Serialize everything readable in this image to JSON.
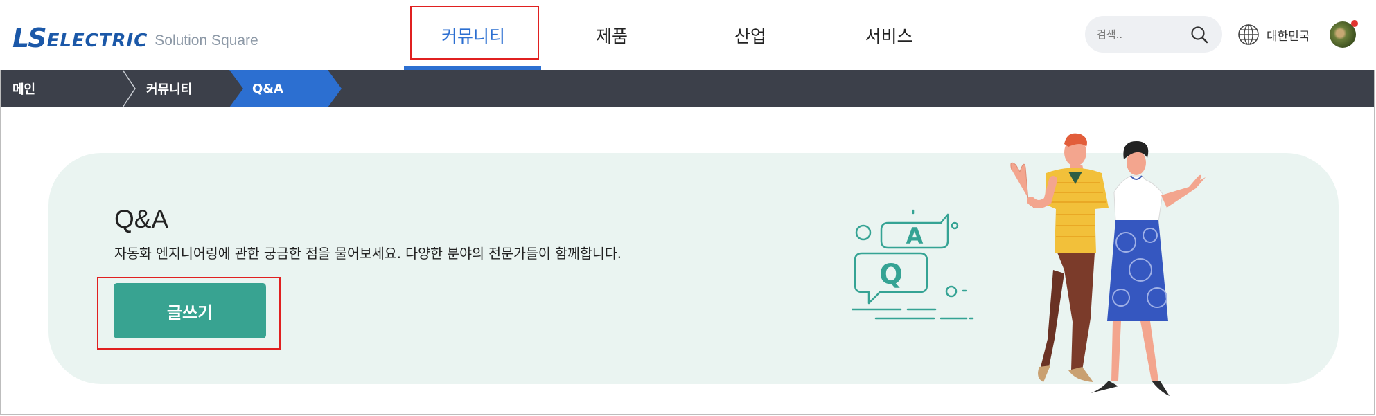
{
  "header": {
    "logo_main": "LS",
    "logo_electric": "ELECTRIC",
    "logo_sub": "Solution Square",
    "nav": [
      {
        "label": "커뮤니티",
        "active": true
      },
      {
        "label": "제품",
        "active": false
      },
      {
        "label": "산업",
        "active": false
      },
      {
        "label": "서비스",
        "active": false
      }
    ],
    "search": {
      "placeholder": "검색..",
      "icon": "search-icon"
    },
    "language": {
      "label": "대한민국",
      "icon": "globe-icon"
    },
    "avatar": {
      "notification": true
    }
  },
  "breadcrumb": [
    {
      "label": "메인"
    },
    {
      "label": "커뮤니티"
    },
    {
      "label": "Q&A",
      "active": true
    }
  ],
  "hero": {
    "title": "Q&A",
    "description": "자동화 엔지니어링에 관한 궁금한 점을 물어보세요. 다양한 분야의 전문가들이 함께합니다.",
    "write_button": "글쓰기",
    "illustration_letters": [
      "A",
      "Q"
    ]
  },
  "colors": {
    "brand_blue": "#1b58a8",
    "nav_active": "#2c6fd1",
    "breadcrumb_bg": "#3c404a",
    "breadcrumb_active": "#2c6fd1",
    "hero_bg": "#eaf4f1",
    "button": "#38a391",
    "highlight_box": "#e02020"
  }
}
